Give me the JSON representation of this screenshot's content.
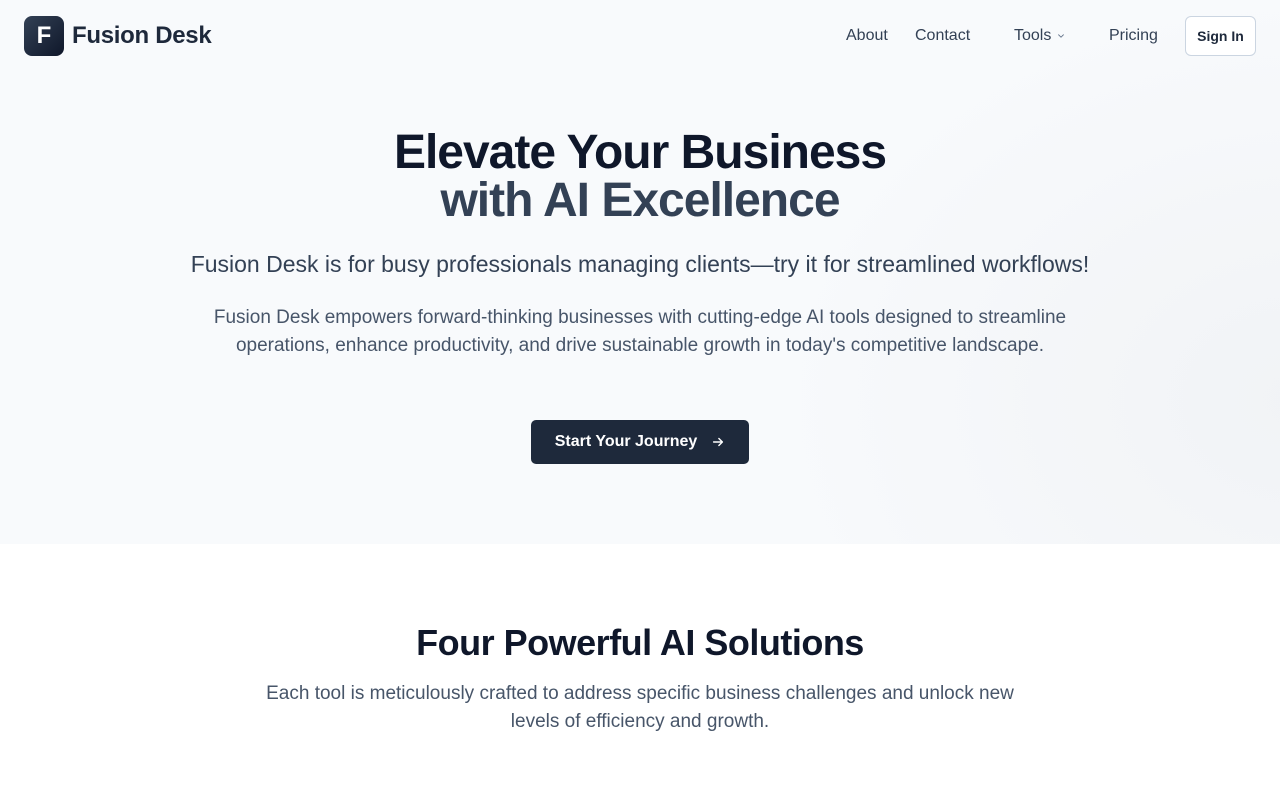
{
  "brand": {
    "logo_letter": "F",
    "name": "Fusion Desk"
  },
  "nav": {
    "about": "About",
    "contact": "Contact",
    "tools": "Tools",
    "pricing": "Pricing",
    "signin": "Sign In"
  },
  "hero": {
    "title_line1": "Elevate Your Business",
    "title_line2": "with AI Excellence",
    "tagline": "Fusion Desk is for busy professionals managing clients—try it for streamlined workflows!",
    "lead": "Fusion Desk empowers forward-thinking businesses with cutting-edge AI tools designed to streamline operations, enhance productivity, and drive sustainable growth in today's competitive landscape.",
    "cta_label": "Start Your Journey",
    "cta_icon": "arrow-right-icon"
  },
  "solutions": {
    "title": "Four Powerful AI Solutions",
    "lead": "Each tool is meticulously crafted to address specific business challenges and unlock new levels of efficiency and growth."
  },
  "colors": {
    "primary": "#1e293b",
    "heading": "#0f172a",
    "muted": "#475569",
    "hero_bg": "#f8fafc"
  }
}
